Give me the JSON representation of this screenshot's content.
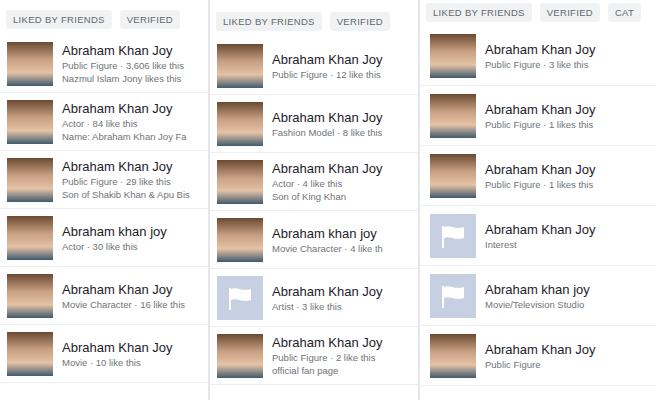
{
  "panels": [
    {
      "filters": [
        {
          "label": "LIKED BY FRIENDS"
        },
        {
          "label": "VERIFIED"
        }
      ],
      "results": [
        {
          "kind": "photo",
          "name": "Abraham Khan Joy",
          "meta": "Public Figure · 3,606 like this",
          "note": "Nazmul Islam Jony likes this"
        },
        {
          "kind": "photo",
          "name": "Abraham Khan Joy",
          "meta": "Actor · 84 like this",
          "note": "Name: Abraham Khan Joy Fa"
        },
        {
          "kind": "photo",
          "name": "Abraham Khan Joy",
          "meta": "Public Figure · 29 like this",
          "note": "Son of Shakib Khan & Apu Bis"
        },
        {
          "kind": "photo",
          "name": "Abraham khan joy",
          "meta": "Actor · 30 like this"
        },
        {
          "kind": "photo",
          "name": "Abraham Khan Joy",
          "meta": "Movie Character · 16 like this"
        },
        {
          "kind": "photo",
          "name": "Abraham Khan Joy",
          "meta": "Movie · 10 like this"
        }
      ]
    },
    {
      "filters": [
        {
          "label": "LIKED BY FRIENDS"
        },
        {
          "label": "VERIFIED"
        }
      ],
      "results": [
        {
          "kind": "photo",
          "name": "Abraham Khan Joy",
          "meta": "Public Figure · 12 like this"
        },
        {
          "kind": "photo",
          "name": "Abraham Khan Joy",
          "meta": "Fashion Model · 8 like this"
        },
        {
          "kind": "photo",
          "name": "Abraham Khan Joy",
          "meta": "Actor · 4 like this",
          "note": "Son of King Khan"
        },
        {
          "kind": "photo",
          "name": "Abraham khan joy",
          "meta": "Movie Character · 4 like th"
        },
        {
          "kind": "flag",
          "name": "Abraham Khan Joy",
          "meta": "Artist · 3 like this"
        },
        {
          "kind": "photo",
          "name": "Abraham Khan Joy",
          "meta": "Public Figure · 2 like this",
          "note": "official fan page"
        }
      ]
    },
    {
      "filters": [
        {
          "label": "LIKED BY FRIENDS"
        },
        {
          "label": "VERIFIED"
        },
        {
          "label": "CAT"
        }
      ],
      "results": [
        {
          "kind": "photo",
          "name": "Abraham Khan Joy",
          "meta": "Public Figure · 3 like this"
        },
        {
          "kind": "photo",
          "name": "Abraham Khan Joy",
          "meta": "Public Figure · 1 likes this"
        },
        {
          "kind": "photo",
          "name": "Abraham Khan Joy",
          "meta": "Public Figure · 1 likes this"
        },
        {
          "kind": "flag",
          "name": "Abraham Khan Joy",
          "meta": "Interest"
        },
        {
          "kind": "flag",
          "name": "Abraham khan joy",
          "meta": "Movie/Television Studio"
        },
        {
          "kind": "photo",
          "name": "Abraham Khan Joy",
          "meta": "Public Figure"
        }
      ]
    }
  ]
}
